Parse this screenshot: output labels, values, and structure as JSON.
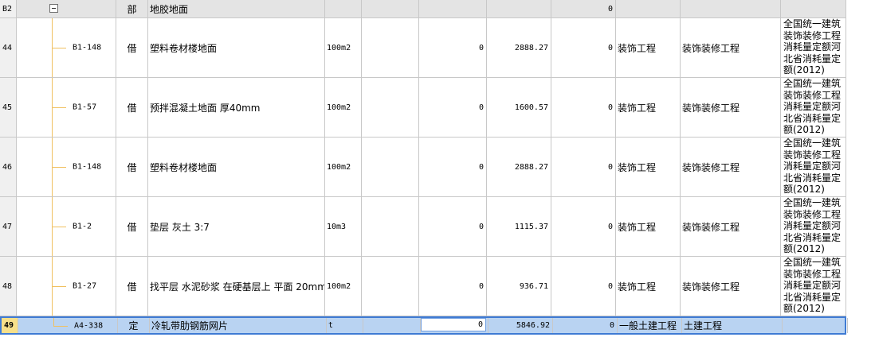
{
  "header_row": {
    "rownum": "B2",
    "type": "部",
    "name": "地胶地面",
    "v2": "0"
  },
  "rows": [
    {
      "rownum": "44",
      "code": "B1-148",
      "type": "借",
      "name": "塑料卷材楼地面",
      "unit": "100m2",
      "v1": "0",
      "price": "2888.27",
      "v2": "0",
      "major": "装饰工程",
      "class": "装饰装修工程",
      "lib": "全国统一建筑装饰装修工程消耗量定额河北省消耗量定额(2012)"
    },
    {
      "rownum": "45",
      "code": "B1-57",
      "type": "借",
      "name": "预拌混凝土地面 厚40mm",
      "unit": "100m2",
      "v1": "0",
      "price": "1600.57",
      "v2": "0",
      "major": "装饰工程",
      "class": "装饰装修工程",
      "lib": "全国统一建筑装饰装修工程消耗量定额河北省消耗量定额(2012)"
    },
    {
      "rownum": "46",
      "code": "B1-148",
      "type": "借",
      "name": "塑料卷材楼地面",
      "unit": "100m2",
      "v1": "0",
      "price": "2888.27",
      "v2": "0",
      "major": "装饰工程",
      "class": "装饰装修工程",
      "lib": "全国统一建筑装饰装修工程消耗量定额河北省消耗量定额(2012)"
    },
    {
      "rownum": "47",
      "code": "B1-2",
      "type": "借",
      "name": "垫层 灰土 3:7",
      "unit": "10m3",
      "v1": "0",
      "price": "1115.37",
      "v2": "0",
      "major": "装饰工程",
      "class": "装饰装修工程",
      "lib": "全国统一建筑装饰装修工程消耗量定额河北省消耗量定额(2012)"
    },
    {
      "rownum": "48",
      "code": "B1-27",
      "type": "借",
      "name": "找平层 水泥砂浆 在硬基层上 平面 20mm",
      "unit": "100m2",
      "v1": "0",
      "price": "936.71",
      "v2": "0",
      "major": "装饰工程",
      "class": "装饰装修工程",
      "lib": "全国统一建筑装饰装修工程消耗量定额河北省消耗量定额(2012)"
    }
  ],
  "selected_row": {
    "rownum": "49",
    "code": "A4-338",
    "type": "定",
    "name": "冷轧带肋钢筋网片",
    "unit": "t",
    "v1": "0",
    "price": "5846.92",
    "v2": "0",
    "major": "一般土建工程",
    "class": "土建工程",
    "lib": ""
  },
  "icons": {
    "collapse": "collapse-minus-icon"
  },
  "colors": {
    "selected_bg": "#b9d3f2",
    "selected_border": "#3f7bd4",
    "header_bg": "#e4e4e4",
    "tree_line": "#f0c060"
  }
}
